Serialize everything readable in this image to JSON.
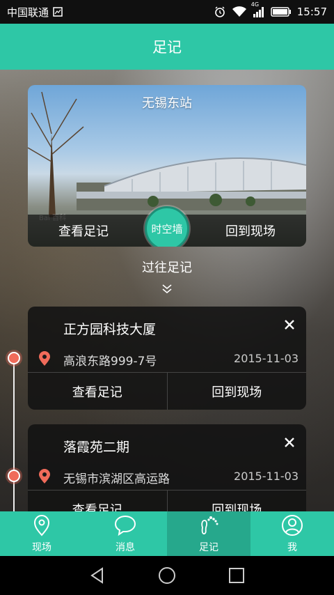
{
  "status_bar": {
    "carrier": "中国联通",
    "network": "4G",
    "time": "15:57"
  },
  "header": {
    "title": "足记"
  },
  "hero": {
    "title": "无锡东站",
    "watermark": "Bai 百科",
    "left_action": "查看足记",
    "center_action": "时空墙",
    "right_action": "回到现场"
  },
  "past_section": {
    "title": "过往足记"
  },
  "records": [
    {
      "name": "正方园科技大厦",
      "address": "高浪东路999-7号",
      "date": "2015-11-03",
      "view_label": "查看足记",
      "return_label": "回到现场"
    },
    {
      "name": "落霞苑二期",
      "address": "无锡市滨湖区高运路",
      "date": "2015-11-03",
      "view_label": "查看足记",
      "return_label": "回到现场"
    }
  ],
  "tabbar": {
    "items": [
      {
        "label": "现场",
        "icon": "location-pin-icon"
      },
      {
        "label": "消息",
        "icon": "chat-bubble-icon"
      },
      {
        "label": "足记",
        "icon": "footprint-icon",
        "active": true
      },
      {
        "label": "我",
        "icon": "user-icon"
      }
    ]
  },
  "colors": {
    "accent": "#2ec7a6",
    "accent_dark": "#26a88c",
    "marker": "#f06b5a"
  }
}
